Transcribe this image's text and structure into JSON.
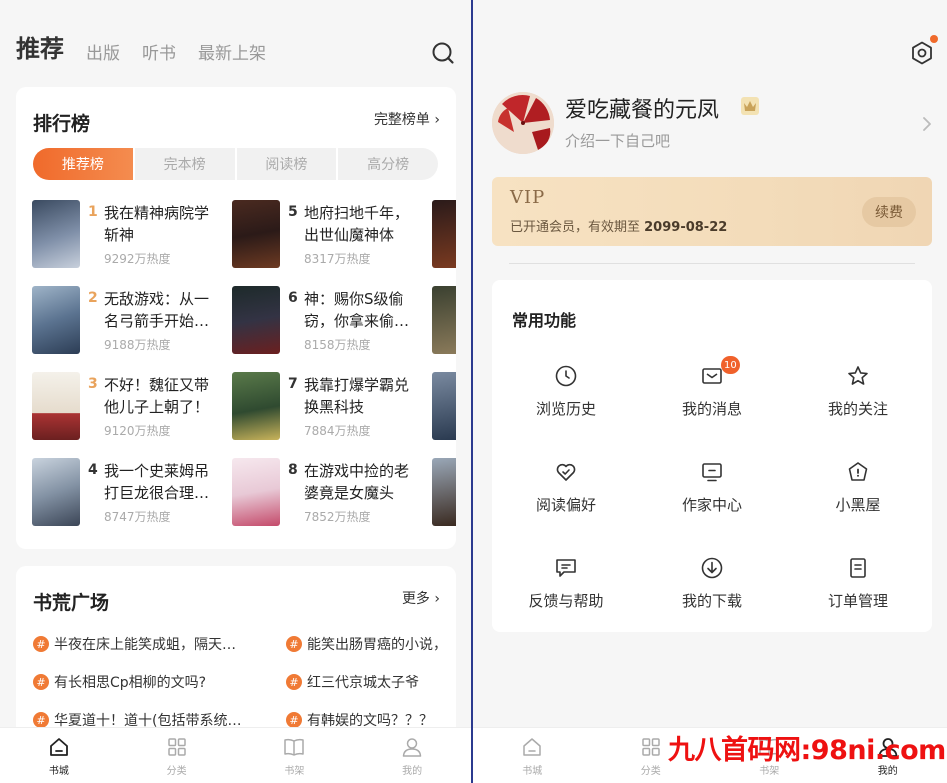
{
  "left": {
    "top_tabs": [
      "推荐",
      "出版",
      "听书",
      "最新上架"
    ],
    "rank": {
      "title": "排行榜",
      "more": "完整榜单",
      "tabs": [
        "推荐榜",
        "完本榜",
        "阅读榜",
        "高分榜"
      ],
      "books": [
        {
          "rank": "1",
          "title": "我在精神病院学斩神",
          "heat": "9292万热度"
        },
        {
          "rank": "2",
          "title": "无敌游戏：从一名弓箭手开始…",
          "heat": "9188万热度"
        },
        {
          "rank": "3",
          "title": "不好！魏征又带他儿子上朝了！",
          "heat": "9120万热度"
        },
        {
          "rank": "4",
          "title": "我一个史莱姆吊打巨龙很合理…",
          "heat": "8747万热度"
        },
        {
          "rank": "5",
          "title": "地府扫地千年，出世仙魔神体",
          "heat": "8317万热度"
        },
        {
          "rank": "6",
          "title": "神：赐你S级偷窃，你拿来偷…",
          "heat": "8158万热度"
        },
        {
          "rank": "7",
          "title": "我靠打爆学霸兑换黑科技",
          "heat": "7884万热度"
        },
        {
          "rank": "8",
          "title": "在游戏中捡的老婆竟是女魔头",
          "heat": "7852万热度"
        }
      ]
    },
    "plaza": {
      "title": "书荒广场",
      "more": "更多",
      "items": [
        "半夜在床上能笑成蛆，隔天…",
        "能笑出肠胃癌的小说，",
        "有长相思Cp相柳的文吗?",
        "红三代京城太子爷",
        "华夏道十！道十(包括带系统…",
        "有韩娱的文吗？？？"
      ]
    },
    "nav": [
      {
        "label": "书城",
        "icon": "bookstore-icon"
      },
      {
        "label": "分类",
        "icon": "category-icon"
      },
      {
        "label": "书架",
        "icon": "bookshelf-icon"
      },
      {
        "label": "我的",
        "icon": "profile-icon"
      }
    ]
  },
  "right": {
    "username": "爱吃藏餐的元凤",
    "intro": "介绍一下自己吧",
    "vip": {
      "title": "VIP",
      "desc_prefix": "已开通会员，有效期至 ",
      "expire": "2099-08-22",
      "renew": "续费"
    },
    "functions_title": "常用功能",
    "functions": [
      {
        "label": "浏览历史",
        "icon": "clock-icon"
      },
      {
        "label": "我的消息",
        "icon": "message-icon",
        "badge": "10"
      },
      {
        "label": "我的关注",
        "icon": "star-icon"
      },
      {
        "label": "阅读偏好",
        "icon": "heart-check-icon"
      },
      {
        "label": "作家中心",
        "icon": "monitor-icon"
      },
      {
        "label": "小黑屋",
        "icon": "house-icon"
      },
      {
        "label": "反馈与帮助",
        "icon": "feedback-icon"
      },
      {
        "label": "我的下载",
        "icon": "download-icon"
      },
      {
        "label": "订单管理",
        "icon": "order-icon"
      }
    ],
    "nav": [
      {
        "label": "书城",
        "icon": "bookstore-icon"
      },
      {
        "label": "分类",
        "icon": "category-icon"
      },
      {
        "label": "书架",
        "icon": "bookshelf-icon"
      },
      {
        "label": "我的",
        "icon": "profile-icon"
      }
    ]
  },
  "watermark": "九八首码网:98ni.com",
  "colors": {
    "accent": "#f06a2b",
    "vip_bg": "#f5dfbe",
    "rank_gold": "#e9a35c"
  }
}
